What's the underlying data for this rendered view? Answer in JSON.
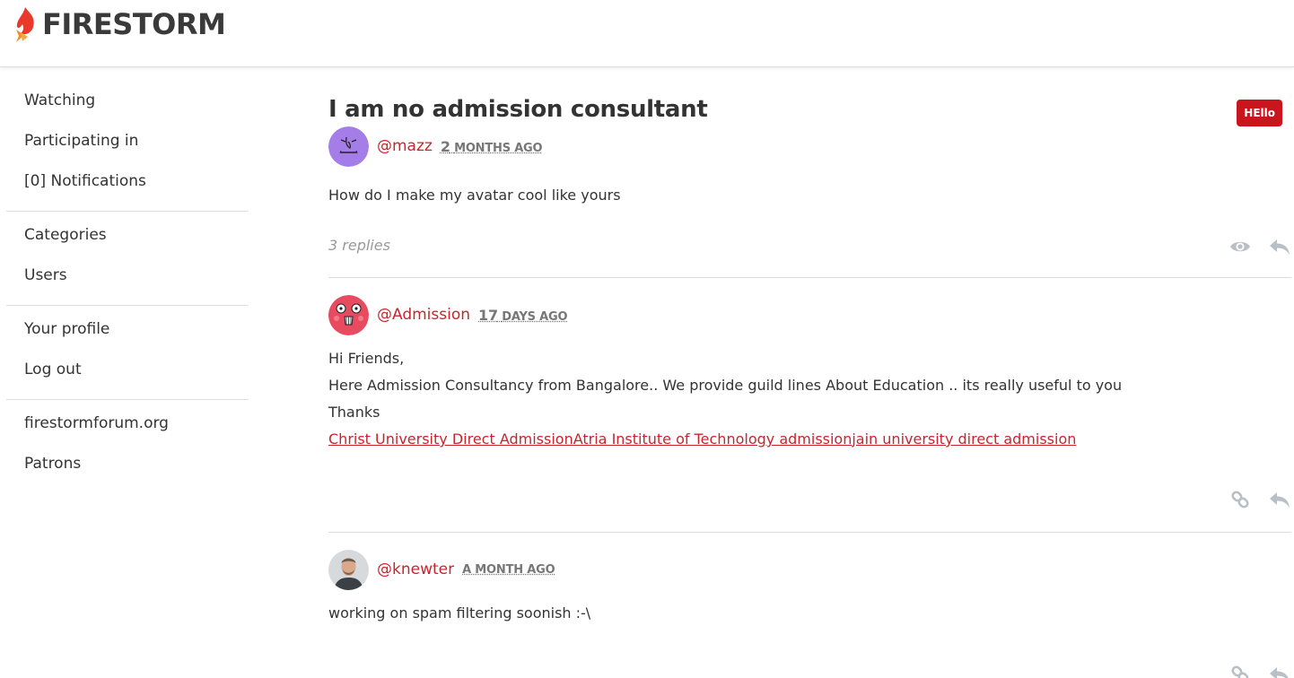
{
  "brand": {
    "name": "FIRESTORM",
    "accent": "#c9242b",
    "flame_colors": [
      "#e8392b",
      "#f28c28"
    ]
  },
  "sidebar": {
    "groups": [
      {
        "items": [
          {
            "label": "Watching"
          },
          {
            "label": "Participating in"
          },
          {
            "label": "[0] Notifications"
          }
        ]
      },
      {
        "items": [
          {
            "label": "Categories"
          },
          {
            "label": "Users"
          }
        ]
      },
      {
        "items": [
          {
            "label": "Your profile"
          },
          {
            "label": "Log out"
          }
        ]
      },
      {
        "items": [
          {
            "label": "firestormforum.org"
          },
          {
            "label": "Patrons"
          }
        ]
      }
    ]
  },
  "thread": {
    "title": "I am no admission consultant",
    "tag": "HEllo",
    "tag_color": "#c9151e",
    "op": {
      "username": "@mazz",
      "time_num": "2",
      "time_unit": "MONTHS AGO",
      "body": "How do I make my avatar cool like yours",
      "replies": "3 replies",
      "avatar_color": "#a57de8",
      "icons": [
        "eye-icon",
        "reply-icon"
      ]
    }
  },
  "posts": [
    {
      "username": "@Admission",
      "time_num": "17",
      "time_unit": "DAYS AGO",
      "lines": [
        "Hi Friends,",
        "Here Admission Consultancy from Bangalore.. We provide guild lines About Education .. its really useful to you",
        "Thanks"
      ],
      "links": [
        "Christ University Direct Admission",
        "Atria Institute of Technology admission",
        "jain university direct admission"
      ],
      "avatar_color": "#e84a5f",
      "icons": [
        "link-icon",
        "reply-icon"
      ]
    },
    {
      "username": "@knewter",
      "time_num": "",
      "time_unit": "A MONTH AGO",
      "lines": [
        "working on spam filtering soonish :-\\"
      ],
      "avatar_color": "#b8bcc0",
      "icons": [
        "link-icon",
        "reply-icon"
      ]
    }
  ]
}
